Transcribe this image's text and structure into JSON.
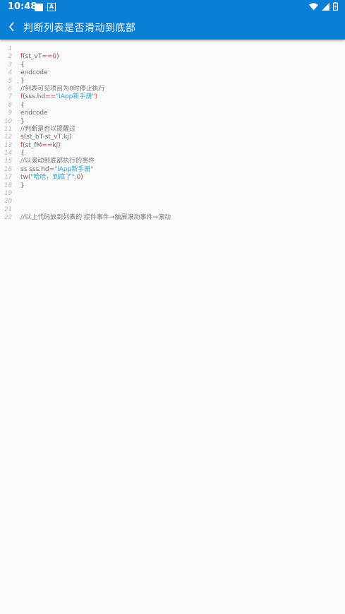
{
  "status_bar": {
    "time": "10:48",
    "notification_icons": [
      "square-icon",
      "a-box-icon"
    ],
    "system_icons": [
      "wifi-icon",
      "cell-signal-icon",
      "battery-icon"
    ]
  },
  "app_bar": {
    "back_icon": "chevron-left-icon",
    "title": "判断列表是否滑动到底部"
  },
  "colors": {
    "primary": "#0a7fd6",
    "background": "#fafafa",
    "keyword": "#d23b3b",
    "brace": "#3a5fd0",
    "string": "#3aa0d0",
    "line_number": "#b5b5b5"
  },
  "code_lines": [
    {
      "n": "1",
      "segments": []
    },
    {
      "n": "2",
      "segments": [
        {
          "t": "f",
          "c": "kw"
        },
        {
          "t": "(st_vT",
          "c": "plain"
        },
        {
          "t": "==",
          "c": "kw"
        },
        {
          "t": "0",
          "c": "kw"
        },
        {
          "t": ")",
          "c": "kw"
        }
      ]
    },
    {
      "n": "3",
      "segments": [
        {
          "t": "{",
          "c": "brace"
        }
      ]
    },
    {
      "n": "4",
      "segments": [
        {
          "t": "endcode",
          "c": "plain"
        }
      ]
    },
    {
      "n": "5",
      "segments": [
        {
          "t": "}",
          "c": "brace"
        }
      ]
    },
    {
      "n": "6",
      "segments": [
        {
          "t": "//列表可见项目为0时停止执行",
          "c": "cmt"
        }
      ]
    },
    {
      "n": "7",
      "segments": [
        {
          "t": "f",
          "c": "kw"
        },
        {
          "t": "(sss.hd",
          "c": "plain"
        },
        {
          "t": "==",
          "c": "kw"
        },
        {
          "t": "\"iApp新手册\"",
          "c": "str"
        },
        {
          "t": ")",
          "c": "kw"
        }
      ]
    },
    {
      "n": "8",
      "segments": [
        {
          "t": "{",
          "c": "brace"
        }
      ]
    },
    {
      "n": "9",
      "segments": [
        {
          "t": "endcode",
          "c": "plain"
        }
      ]
    },
    {
      "n": "10",
      "segments": [
        {
          "t": "}",
          "c": "brace"
        }
      ]
    },
    {
      "n": "11",
      "segments": [
        {
          "t": "//判断是否以提醒过",
          "c": "cmt"
        }
      ]
    },
    {
      "n": "12",
      "segments": [
        {
          "t": "s",
          "c": "kw"
        },
        {
          "t": "(st_bT-st_vT,kj",
          "c": "plain"
        },
        {
          "t": ")",
          "c": "kw"
        }
      ]
    },
    {
      "n": "13",
      "segments": [
        {
          "t": "f",
          "c": "kw"
        },
        {
          "t": "(st_fM",
          "c": "plain"
        },
        {
          "t": "==",
          "c": "kw"
        },
        {
          "t": "kj",
          "c": "plain"
        },
        {
          "t": ")",
          "c": "kw"
        }
      ]
    },
    {
      "n": "14",
      "segments": [
        {
          "t": "{",
          "c": "brace"
        }
      ]
    },
    {
      "n": "15",
      "segments": [
        {
          "t": "//以滚动到底部执行的事件",
          "c": "cmt"
        }
      ]
    },
    {
      "n": "16",
      "segments": [
        {
          "t": "ss sss.hd=",
          "c": "plain"
        },
        {
          "t": "\"iApp新手册\"",
          "c": "str"
        }
      ]
    },
    {
      "n": "17",
      "segments": [
        {
          "t": "tw",
          "c": "plain"
        },
        {
          "t": "(",
          "c": "kw"
        },
        {
          "t": "\"哈哈，到底了\"",
          "c": "str"
        },
        {
          "t": ",0",
          "c": "plain"
        },
        {
          "t": ")",
          "c": "kw"
        }
      ]
    },
    {
      "n": "18",
      "segments": [
        {
          "t": "}",
          "c": "brace"
        }
      ]
    },
    {
      "n": "19",
      "segments": []
    },
    {
      "n": "20",
      "segments": []
    },
    {
      "n": "21",
      "segments": []
    },
    {
      "n": "22",
      "segments": [
        {
          "t": "//以上代码放到列表的 控件事件→触屏滚动事件→滚动",
          "c": "cmt"
        }
      ]
    }
  ]
}
